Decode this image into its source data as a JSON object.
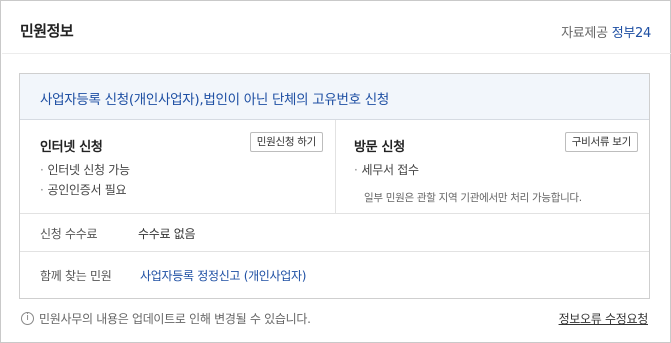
{
  "header": {
    "title": "민원정보",
    "provider_label": "자료제공",
    "provider_name": "정부24"
  },
  "service": {
    "title": "사업자등록 신청(개인사업자),법인이 아닌 단체의 고유번호 신청",
    "online": {
      "heading": "인터넷 신청",
      "button": "민원신청 하기",
      "items": [
        "인터넷 신청 가능",
        "공인인증서 필요"
      ]
    },
    "visit": {
      "heading": "방문 신청",
      "button": "구비서류 보기",
      "items": [
        "세무서 접수"
      ],
      "note": "일부 민원은 관할 지역 기관에서만 처리 가능합니다."
    },
    "fee": {
      "label": "신청 수수료",
      "value": "수수료 없음"
    },
    "related": {
      "label": "함께 찾는 민원",
      "link": "사업자등록 정정신고 (개인사업자)"
    }
  },
  "footer": {
    "info_icon": "i",
    "notice": "민원사무의 내용은 업데이트로 인해 변경될 수 있습니다.",
    "report_link": "정보오류 수정요청"
  },
  "colors": {
    "accent": "#1e4fa3",
    "head_bg": "#f2f6fb",
    "border": "#cfcfcf"
  }
}
